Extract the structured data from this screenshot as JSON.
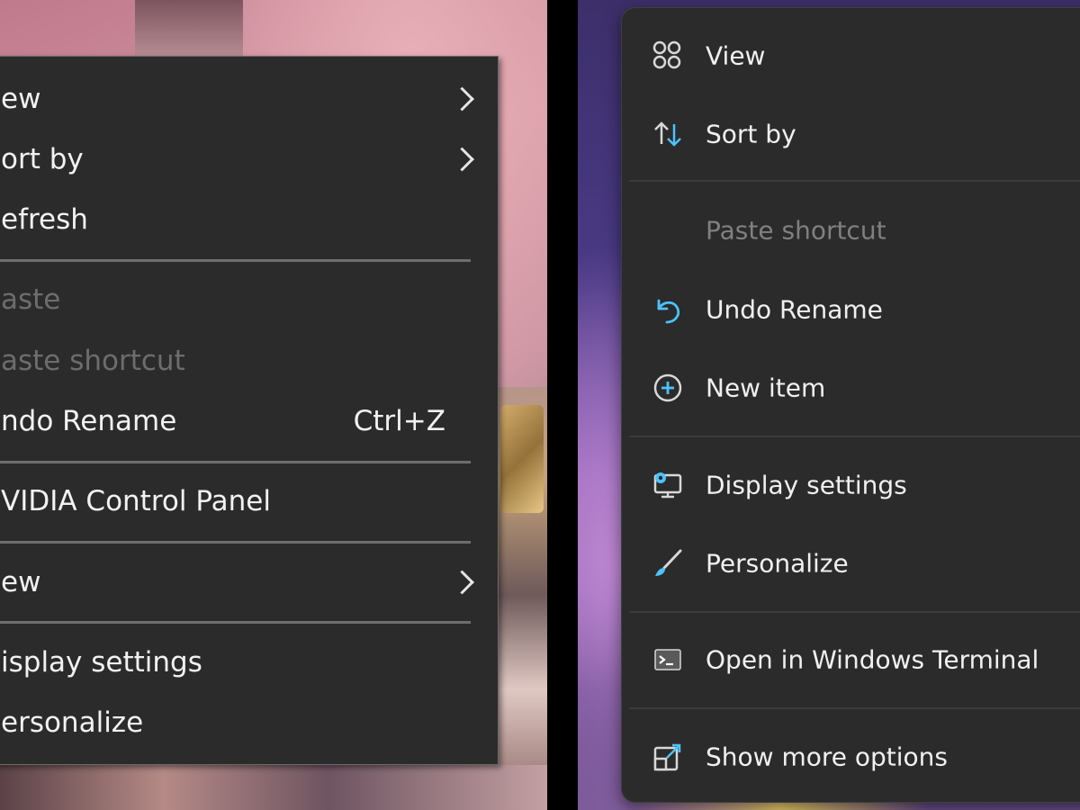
{
  "left_menu": {
    "items": [
      {
        "label": "ew",
        "has_submenu": true,
        "disabled": false
      },
      {
        "label": "ort by",
        "has_submenu": true,
        "disabled": false
      },
      {
        "label": "efresh",
        "has_submenu": false,
        "disabled": false
      },
      {
        "label": "aste",
        "has_submenu": false,
        "disabled": true
      },
      {
        "label": "aste shortcut",
        "has_submenu": false,
        "disabled": true
      },
      {
        "label": "ndo Rename",
        "shortcut": "Ctrl+Z",
        "has_submenu": false,
        "disabled": false
      },
      {
        "label": "VIDIA Control Panel",
        "has_submenu": false,
        "disabled": false
      },
      {
        "label": "ew",
        "has_submenu": true,
        "disabled": false
      },
      {
        "label": "isplay settings",
        "has_submenu": false,
        "disabled": false
      },
      {
        "label": "ersonalize",
        "has_submenu": false,
        "disabled": false
      }
    ]
  },
  "right_menu": {
    "items": [
      {
        "label": "View",
        "icon": "view-grid-icon",
        "disabled": false
      },
      {
        "label": "Sort by",
        "icon": "sort-arrows-icon",
        "disabled": false
      },
      {
        "label": "Paste shortcut",
        "icon": "",
        "disabled": true
      },
      {
        "label": "Undo Rename",
        "icon": "undo-icon",
        "disabled": false
      },
      {
        "label": "New item",
        "icon": "new-item-plus-icon",
        "disabled": false
      },
      {
        "label": "Display settings",
        "icon": "display-settings-icon",
        "disabled": false
      },
      {
        "label": "Personalize",
        "icon": "brush-icon",
        "disabled": false
      },
      {
        "label": "Open in Windows Terminal",
        "icon": "terminal-icon",
        "disabled": false
      },
      {
        "label": "Show more options",
        "icon": "show-more-options-icon",
        "disabled": false
      }
    ]
  },
  "colors": {
    "menu_bg": "#2b2b2b",
    "text": "#f2f2f2",
    "disabled_text": "#6d6d6d",
    "accent_blue": "#4cc2ff"
  }
}
